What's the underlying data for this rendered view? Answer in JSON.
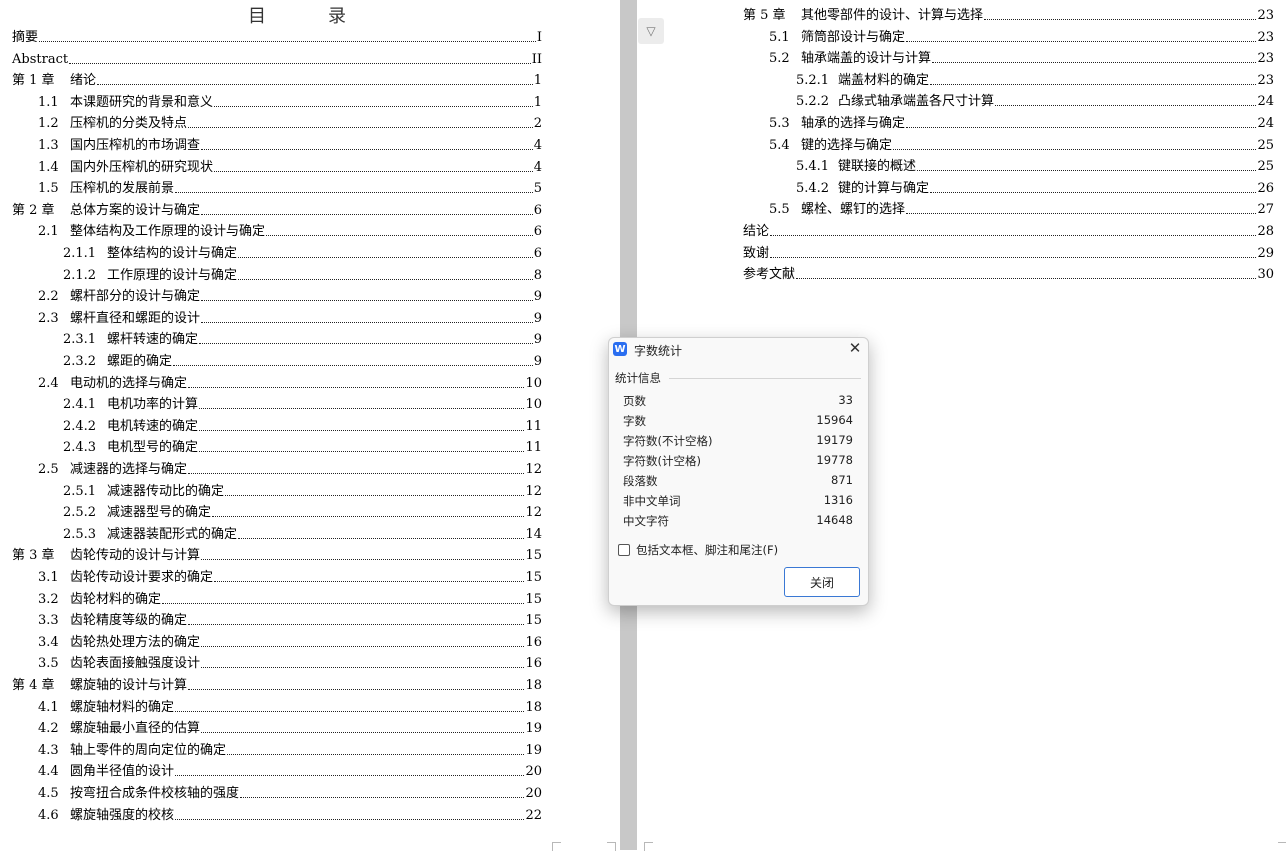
{
  "toc_title": "目　录",
  "left_entries": [
    {
      "num": "",
      "text": "摘要",
      "page": "I"
    },
    {
      "num": "",
      "text": "Abstract",
      "page": "II"
    },
    {
      "num": "第 1 章",
      "text": "绪论",
      "page": "1"
    },
    {
      "num": "1.1",
      "text": "本课题研究的背景和意义",
      "page": "1"
    },
    {
      "num": "1.2",
      "text": "压榨机的分类及特点",
      "page": "2"
    },
    {
      "num": "1.3",
      "text": "国内压榨机的市场调查",
      "page": "4"
    },
    {
      "num": "1.4",
      "text": "国内外压榨机的研究现状",
      "page": "4"
    },
    {
      "num": "1.5",
      "text": "压榨机的发展前景",
      "page": "5"
    },
    {
      "num": "第 2 章",
      "text": "总体方案的设计与确定",
      "page": "6"
    },
    {
      "num": "2.1",
      "text": "整体结构及工作原理的设计与确定",
      "page": "6"
    },
    {
      "num": "2.1.1",
      "text": "整体结构的设计与确定",
      "page": "6"
    },
    {
      "num": "2.1.2",
      "text": "工作原理的设计与确定",
      "page": "8"
    },
    {
      "num": "2.2",
      "text": "螺杆部分的设计与确定",
      "page": "9"
    },
    {
      "num": "2.3",
      "text": "螺杆直径和螺距的设计",
      "page": "9"
    },
    {
      "num": "2.3.1",
      "text": "螺杆转速的确定",
      "page": "9"
    },
    {
      "num": "2.3.2",
      "text": "螺距的确定",
      "page": "9"
    },
    {
      "num": "2.4",
      "text": "电动机的选择与确定",
      "page": "10"
    },
    {
      "num": "2.4.1",
      "text": "电机功率的计算",
      "page": "10"
    },
    {
      "num": "2.4.2",
      "text": "电机转速的确定",
      "page": "11"
    },
    {
      "num": "2.4.3",
      "text": "电机型号的确定",
      "page": "11"
    },
    {
      "num": "2.5",
      "text": "减速器的选择与确定",
      "page": "12"
    },
    {
      "num": "2.5.1",
      "text": "减速器传动比的确定",
      "page": "12"
    },
    {
      "num": "2.5.2",
      "text": "减速器型号的确定",
      "page": "12"
    },
    {
      "num": "2.5.3",
      "text": "减速器装配形式的确定",
      "page": "14"
    },
    {
      "num": "第 3 章",
      "text": "齿轮传动的设计与计算",
      "page": "15"
    },
    {
      "num": "3.1",
      "text": "齿轮传动设计要求的确定",
      "page": "15"
    },
    {
      "num": "3.2",
      "text": "齿轮材料的确定",
      "page": "15"
    },
    {
      "num": "3.3",
      "text": "齿轮精度等级的确定",
      "page": "15"
    },
    {
      "num": "3.4",
      "text": "齿轮热处理方法的确定",
      "page": "16"
    },
    {
      "num": "3.5",
      "text": "齿轮表面接触强度设计",
      "page": "16"
    },
    {
      "num": "第 4 章",
      "text": "螺旋轴的设计与计算",
      "page": "18"
    },
    {
      "num": "4.1",
      "text": "螺旋轴材料的确定",
      "page": "18"
    },
    {
      "num": "4.2",
      "text": "螺旋轴最小直径的估算",
      "page": "19"
    },
    {
      "num": "4.3",
      "text": "轴上零件的周向定位的确定",
      "page": "19"
    },
    {
      "num": "4.4",
      "text": "圆角半径值的设计",
      "page": "20"
    },
    {
      "num": "4.5",
      "text": "按弯扭合成条件校核轴的强度",
      "page": "20"
    },
    {
      "num": "4.6",
      "text": "螺旋轴强度的校核",
      "page": "22"
    }
  ],
  "right_entries": [
    {
      "num": "第 5 章",
      "text": "其他零部件的设计、计算与选择",
      "page": "23"
    },
    {
      "num": "5.1",
      "text": "筛筒部设计与确定",
      "page": "23"
    },
    {
      "num": "5.2",
      "text": "轴承端盖的设计与计算",
      "page": "23"
    },
    {
      "num": "5.2.1",
      "text": "端盖材料的确定",
      "page": "23"
    },
    {
      "num": "5.2.2",
      "text": "凸缘式轴承端盖各尺寸计算",
      "page": "24"
    },
    {
      "num": "5.3",
      "text": "轴承的选择与确定",
      "page": "24"
    },
    {
      "num": "5.4",
      "text": "键的选择与确定",
      "page": "25"
    },
    {
      "num": "5.4.1",
      "text": "键联接的概述",
      "page": "25"
    },
    {
      "num": "5.4.2",
      "text": "键的计算与确定",
      "page": "26"
    },
    {
      "num": "5.5",
      "text": "螺栓、螺钉的选择",
      "page": "27"
    },
    {
      "num": "",
      "text": "结论",
      "page": "28"
    },
    {
      "num": "",
      "text": "致谢",
      "page": "29"
    },
    {
      "num": "",
      "text": "参考文献",
      "page": "30"
    }
  ],
  "dialog": {
    "icon_letter": "W",
    "title": "字数统计",
    "group_label": "统计信息",
    "stats": [
      {
        "label": "页数",
        "value": "33"
      },
      {
        "label": "字数",
        "value": "15964"
      },
      {
        "label": "字符数(不计空格)",
        "value": "19179"
      },
      {
        "label": "字符数(计空格)",
        "value": "19778"
      },
      {
        "label": "段落数",
        "value": "871"
      },
      {
        "label": "非中文单词",
        "value": "1316"
      },
      {
        "label": "中文字符",
        "value": "14648"
      }
    ],
    "checkbox_label": "包括文本框、脚注和尾注(F)",
    "checkbox_checked": false,
    "close_button": "关闭"
  },
  "fold_icon": "chevron-down-icon"
}
